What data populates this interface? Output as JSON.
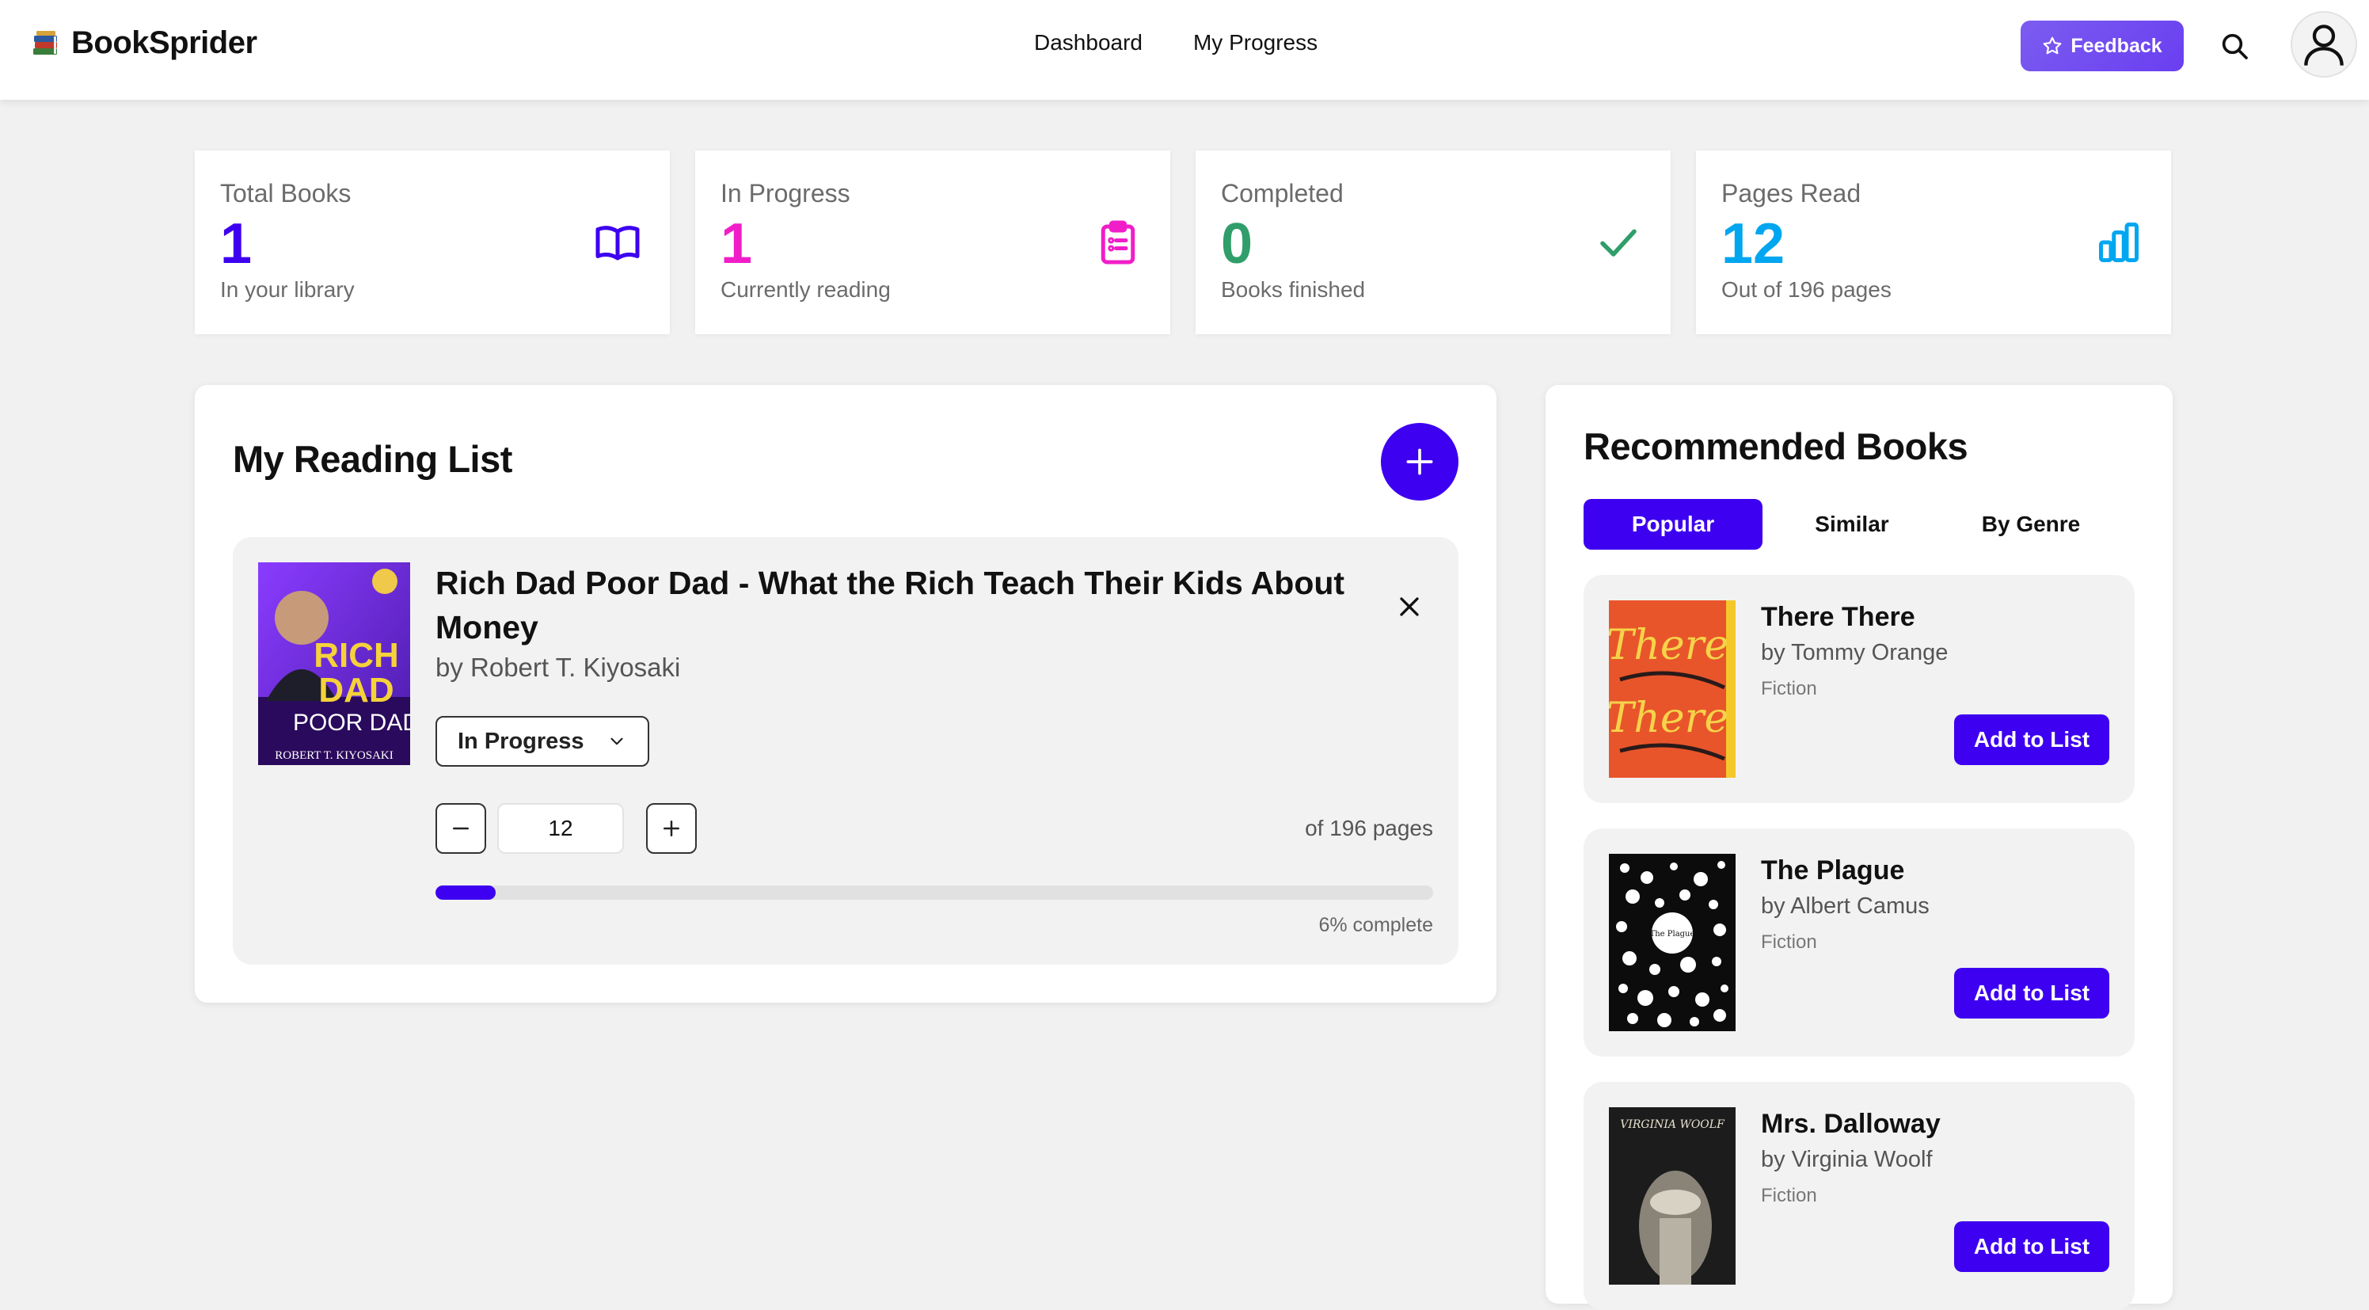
{
  "header": {
    "brand": "BookSprider",
    "nav": [
      "Dashboard",
      "My Progress"
    ],
    "feedback_label": "Feedback",
    "icons": [
      "books-logo-icon",
      "star-icon",
      "search-icon",
      "user-avatar-icon"
    ]
  },
  "stats": [
    {
      "label": "Total Books",
      "value": "1",
      "sub": "In your library",
      "color": "#3d00f0",
      "icon": "book-open-icon"
    },
    {
      "label": "In Progress",
      "value": "1",
      "sub": "Currently reading",
      "color": "#f01ec8",
      "icon": "clipboard-list-icon"
    },
    {
      "label": "Completed",
      "value": "0",
      "sub": "Books finished",
      "color": "#2f9e6a",
      "icon": "check-icon"
    },
    {
      "label": "Pages Read",
      "value": "12",
      "sub": "Out of 196 pages",
      "color": "#00a6f0",
      "icon": "bar-chart-icon"
    }
  ],
  "reading_list": {
    "title": "My Reading List",
    "items": [
      {
        "title": "Rich Dad Poor Dad - What the Rich Teach Their Kids About Money",
        "author": "by Robert T. Kiyosaki",
        "status": "In Progress",
        "current_page": "12",
        "pages_of": "of 196 pages",
        "progress_fraction": 0.06,
        "progress_text": "6% complete",
        "cover_text": {
          "line1": "RICH",
          "line2": "DAD",
          "line3": "POOR DAD",
          "author": "ROBERT T. KIYOSAKI"
        }
      }
    ]
  },
  "recommended": {
    "title": "Recommended Books",
    "tabs": [
      "Popular",
      "Similar",
      "By Genre"
    ],
    "active_tab": 0,
    "add_label": "Add to List",
    "books": [
      {
        "title": "There There",
        "author": "by Tommy Orange",
        "genre": "Fiction",
        "cover_text": "There"
      },
      {
        "title": "The Plague",
        "author": "by Albert Camus",
        "genre": "Fiction",
        "cover_text": "The Plague"
      },
      {
        "title": "Mrs. Dalloway",
        "author": "by Virginia Woolf",
        "genre": "Fiction",
        "cover_text": "VIRGINIA WOOLF"
      }
    ]
  },
  "colors": {
    "accent": "#3d00f0",
    "feedback": "#6a3ff0",
    "pink": "#f01ec8",
    "green": "#2f9e6a",
    "blue": "#00a6f0"
  }
}
